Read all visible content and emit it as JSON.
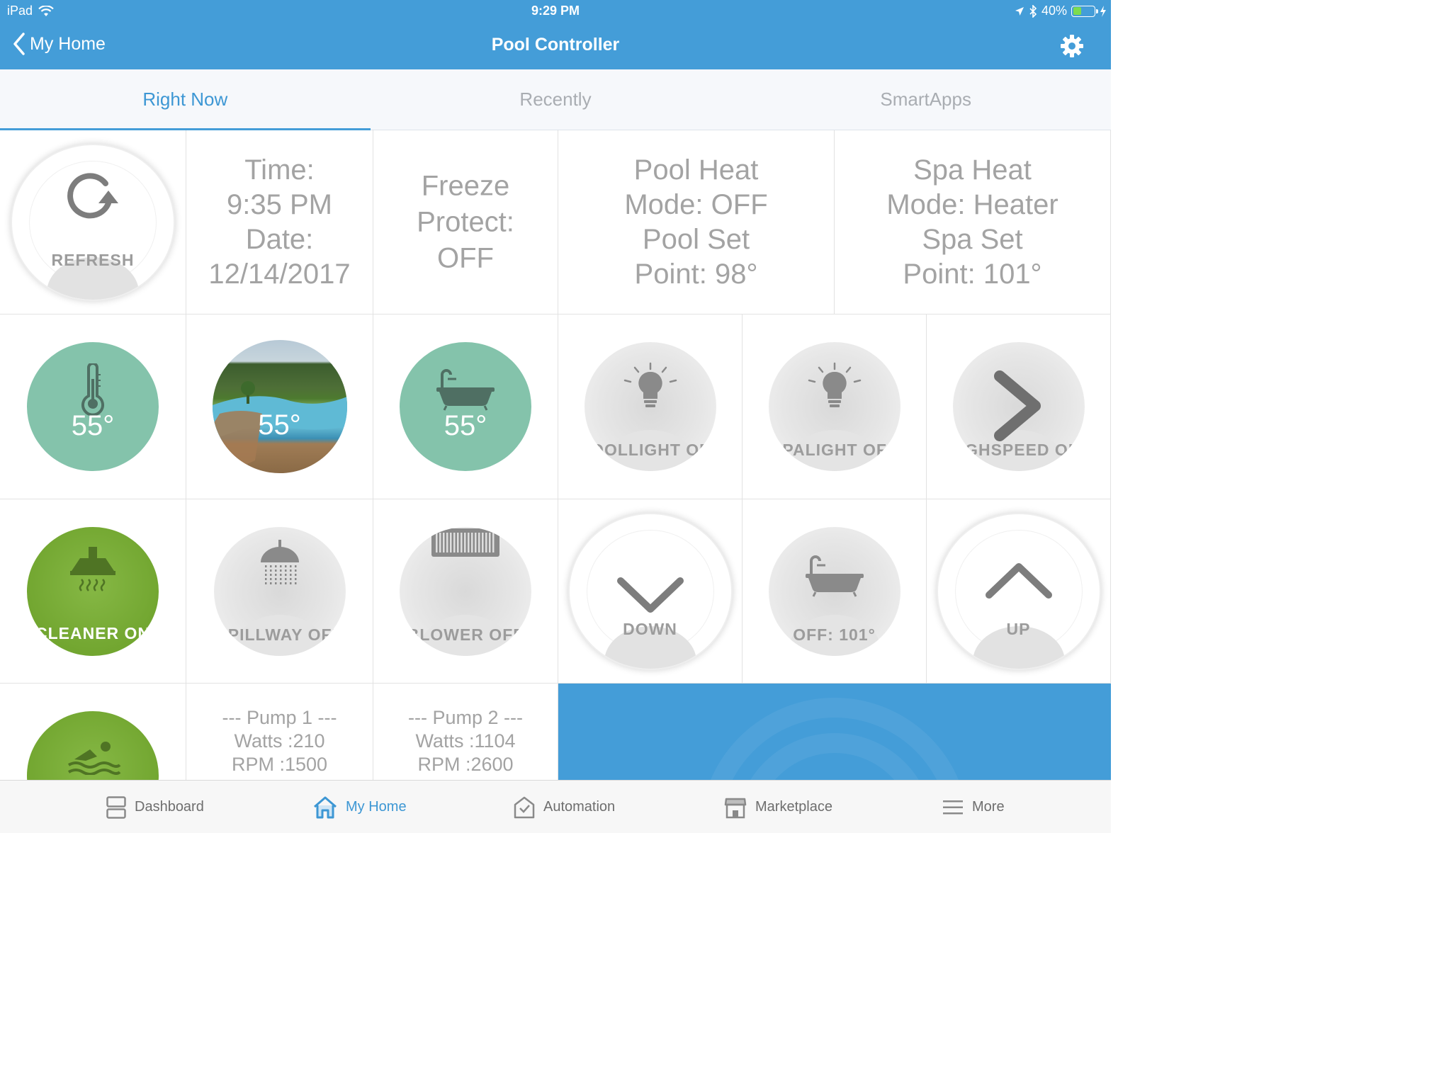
{
  "status_bar": {
    "device": "iPad",
    "time": "9:29 PM",
    "battery": "40%",
    "battery_level": 0.4
  },
  "nav": {
    "back_label": "My Home",
    "title": "Pool Controller"
  },
  "tabs": [
    {
      "label": "Right Now",
      "active": true
    },
    {
      "label": "Recently",
      "active": false
    },
    {
      "label": "SmartApps",
      "active": false
    }
  ],
  "tiles": {
    "refresh": {
      "label": "REFRESH"
    },
    "time_info": {
      "lines": [
        "Time:",
        "9:35 PM",
        "Date:",
        "12/14/2017"
      ]
    },
    "freeze": {
      "lines": [
        "Freeze",
        "Protect:",
        "OFF"
      ]
    },
    "pool_heat": {
      "lines": [
        "Pool Heat",
        "Mode: OFF",
        "Pool Set",
        "Point: 98°"
      ]
    },
    "spa_heat": {
      "lines": [
        "Spa Heat",
        "Mode: Heater",
        "Spa Set",
        "Point: 101°"
      ]
    },
    "air_temp": {
      "label": "55°"
    },
    "pool_temp": {
      "label": "55°"
    },
    "spa_temp": {
      "label": "55°"
    },
    "poollight": {
      "label": "POOLLIGHT OFF"
    },
    "spalight": {
      "label": "SPALIGHT OFF"
    },
    "highspeed": {
      "label": "HIGHSPEED OFF"
    },
    "cleaner": {
      "label": "CLEANER ON"
    },
    "spillway": {
      "label": "SPILLWAY OFF"
    },
    "blower": {
      "label": "BLOWER OFF"
    },
    "down": {
      "label": "DOWN"
    },
    "spa_setpoint": {
      "label": "OFF: 101°"
    },
    "up": {
      "label": "UP"
    },
    "pump1": {
      "lines": [
        "--- Pump 1 ---",
        "Watts :210",
        "RPM :1500"
      ]
    },
    "pump2": {
      "lines": [
        "--- Pump 2 ---",
        "Watts :1104",
        "RPM :2600"
      ]
    }
  },
  "bottom_nav": [
    {
      "label": "Dashboard",
      "icon": "dashboard-icon",
      "active": false
    },
    {
      "label": "My Home",
      "icon": "home-icon",
      "active": true
    },
    {
      "label": "Automation",
      "icon": "automation-icon",
      "active": false
    },
    {
      "label": "Marketplace",
      "icon": "marketplace-icon",
      "active": false
    },
    {
      "label": "More",
      "icon": "menu-icon",
      "active": false
    }
  ],
  "colors": {
    "accent": "#449dd8",
    "teal_tile": "#84c3ab",
    "green_tile": "#72a630",
    "inactive_text": "#a3a3a3"
  }
}
